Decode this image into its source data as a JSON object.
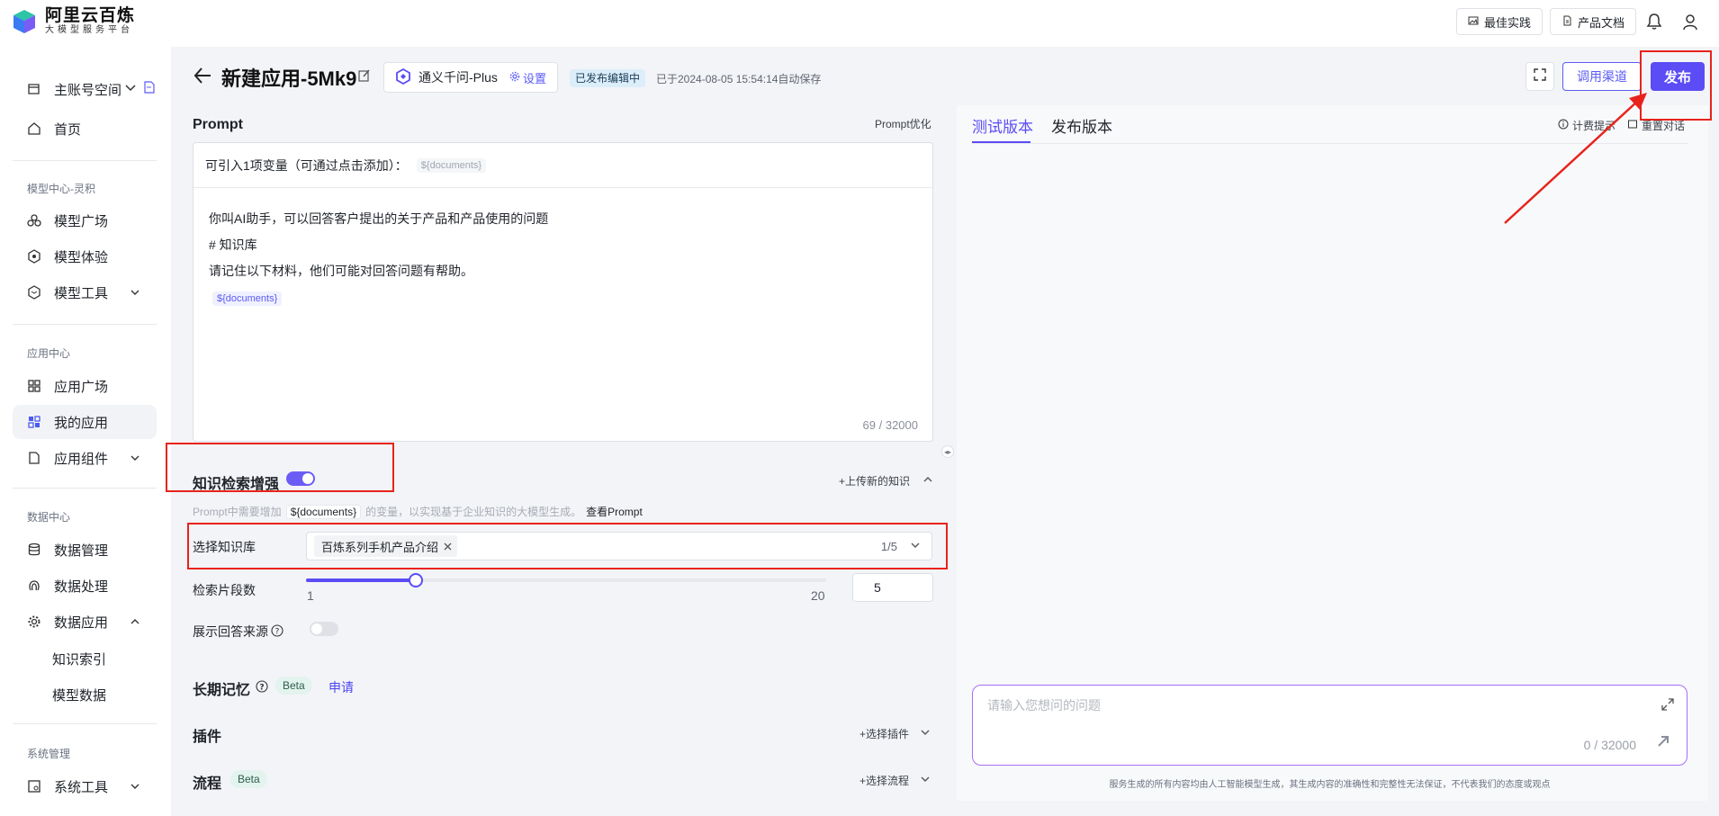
{
  "brand": {
    "name": "阿里云百炼",
    "tagline": "大模型服务平台"
  },
  "topbar": {
    "best_practice": "最佳实践",
    "product_docs": "产品文档"
  },
  "sidebar": {
    "account": "主账号空间",
    "home": "首页",
    "groups": {
      "model_center": "模型中心-灵积",
      "app_center": "应用中心",
      "data_center": "数据中心",
      "system": "系统管理"
    },
    "items": {
      "model_square": "模型广场",
      "model_experience": "模型体验",
      "model_tools": "模型工具",
      "app_square": "应用广场",
      "my_apps": "我的应用",
      "app_components": "应用组件",
      "data_manage": "数据管理",
      "data_process": "数据处理",
      "data_apps": "数据应用",
      "knowledge_index": "知识索引",
      "model_data": "模型数据",
      "system_tools": "系统工具"
    }
  },
  "header": {
    "title": "新建应用-5Mk9",
    "model": "通义千问-Plus",
    "model_setting": "设置",
    "status_badge": "已发布编辑中",
    "autosave": "已于2024-08-05 15:54:14自动保存",
    "channel_button": "调用渠道",
    "publish_button": "发布"
  },
  "prompt": {
    "section_title": "Prompt",
    "optimize_link": "Prompt优化",
    "var_hint": "可引入1项变量（可通过点击添加）：",
    "var_name": "${documents}",
    "lines": [
      "你叫AI助手，可以回答客户提出的关于产品和产品使用的问题",
      "# 知识库",
      "请记住以下材料，他们可能对回答问题有帮助。"
    ],
    "var_in_body": "${documents}",
    "char_count": "69 / 32000"
  },
  "knowledge": {
    "title": "知识检索增强",
    "enabled": true,
    "upload_link": "+上传新的知识",
    "desc_pre": "Prompt中需要增加",
    "desc_var": "${documents}",
    "desc_mid": "的变量，以实现基于企业知识的大模型生成。",
    "desc_link": "查看Prompt",
    "select_label": "选择知识库",
    "selected_kb": "百炼系列手机产品介绍",
    "selected_count": "1/5",
    "segments_label": "检索片段数",
    "segments_min": "1",
    "segments_max": "20",
    "segments_value": "5",
    "show_source_label": "展示回答来源",
    "show_source_enabled": false
  },
  "memory": {
    "title": "长期记忆",
    "beta": "Beta",
    "apply": "申请"
  },
  "plugins": {
    "title": "插件",
    "link": "+选择插件"
  },
  "flow": {
    "title": "流程",
    "beta": "Beta",
    "link": "+选择流程"
  },
  "test_panel": {
    "tab_test": "测试版本",
    "tab_release": "发布版本",
    "billing_tip": "计费提示",
    "reset_chat": "重置对话",
    "input_placeholder": "请输入您想问的问题",
    "input_count": "0 / 32000",
    "disclaimer": "服务生成的所有内容均由人工智能模型生成，其生成内容的准确性和完整性无法保证，不代表我们的态度或观点"
  },
  "colors": {
    "accent": "#5b4cf5",
    "annotation_red": "#e8231c"
  }
}
